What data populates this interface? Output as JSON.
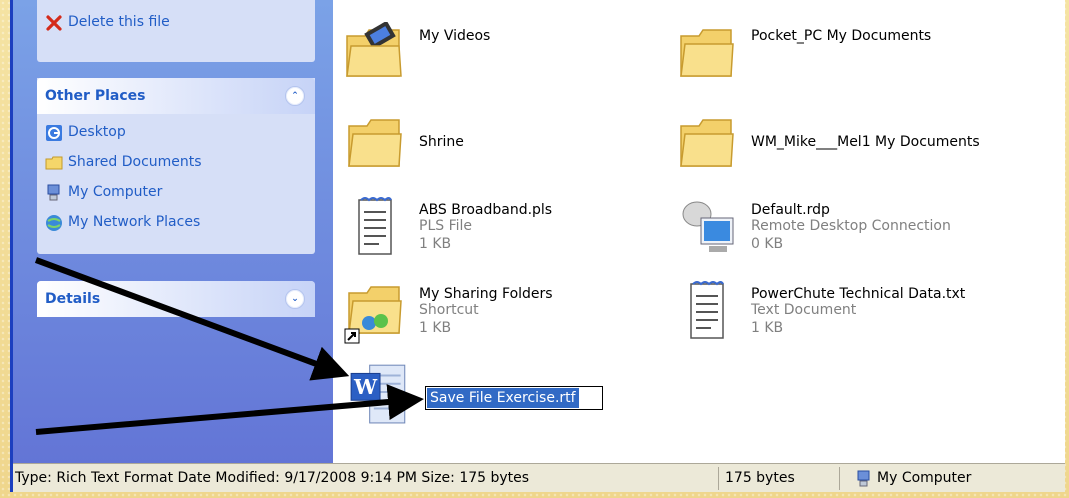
{
  "tasks": {
    "delete_label": "Delete this file"
  },
  "other_places": {
    "title": "Other Places",
    "items": [
      {
        "label": "Desktop",
        "icon": "desktop-icon"
      },
      {
        "label": "Shared Documents",
        "icon": "shared-folder-icon"
      },
      {
        "label": "My Computer",
        "icon": "computer-icon"
      },
      {
        "label": "My Network Places",
        "icon": "network-icon"
      }
    ]
  },
  "details": {
    "title": "Details"
  },
  "files": [
    {
      "name": "My Videos",
      "type": "",
      "size": "",
      "icon": "video-folder-icon"
    },
    {
      "name": "Pocket_PC My Documents",
      "type": "",
      "size": "",
      "icon": "folder-icon"
    },
    {
      "name": "Shrine",
      "type": "",
      "size": "",
      "icon": "folder-icon"
    },
    {
      "name": "WM_Mike___Mel1 My Documents",
      "type": "",
      "size": "",
      "icon": "folder-icon"
    },
    {
      "name": "ABS Broadband.pls",
      "type": "PLS File",
      "size": "1 KB",
      "icon": "text-file-icon"
    },
    {
      "name": "Default.rdp",
      "type": "Remote Desktop Connection",
      "size": "0 KB",
      "icon": "remote-desktop-icon"
    },
    {
      "name": "My Sharing Folders",
      "type": "Shortcut",
      "size": "1 KB",
      "icon": "shared-folder-shortcut-icon"
    },
    {
      "name": "PowerChute Technical Data.txt",
      "type": "Text Document",
      "size": "1 KB",
      "icon": "text-file-icon"
    },
    {
      "name": "Save File Exercise.rtf",
      "type": "",
      "size": "",
      "icon": "word-document-icon"
    }
  ],
  "statusbar": {
    "info": "Type: Rich Text Format Date Modified: 9/17/2008 9:14 PM Size: 175 bytes",
    "size": "175 bytes",
    "location": "My Computer"
  },
  "colors": {
    "accent": "#215dc6",
    "selection": "#316ac5",
    "taskpane": "#6f8ddf",
    "arrow": "#000000"
  }
}
